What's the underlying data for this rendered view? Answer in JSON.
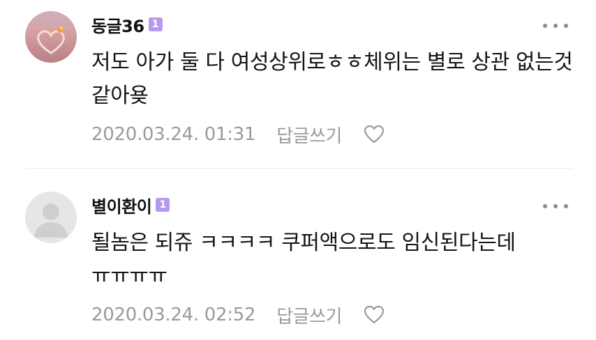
{
  "comments": [
    {
      "username": "동글36",
      "level": "1",
      "text": "저도 아가 둘 다 여성상위로ㅎㅎ체위는 별로 상관 없는것 같아욪",
      "timestamp": "2020.03.24. 01:31",
      "reply_label": "답글쓰기",
      "avatar_icon": "beach-heart-photo",
      "more_icon": "more-dots-icon",
      "like_icon": "heart-outline-icon"
    },
    {
      "username": "별이환이",
      "level": "1",
      "text": "될놈은 되쥬 ㅋㅋㅋㅋ 쿠퍼액으로도 임신된다는데 ㅠㅠㅠㅠ",
      "timestamp": "2020.03.24. 02:52",
      "reply_label": "답글쓰기",
      "avatar_icon": "default-user-icon",
      "more_icon": "more-dots-icon",
      "like_icon": "heart-outline-icon"
    }
  ],
  "colors": {
    "level_badge": "#b69af0",
    "meta_text": "#9a9a9a",
    "divider": "#ececec"
  }
}
